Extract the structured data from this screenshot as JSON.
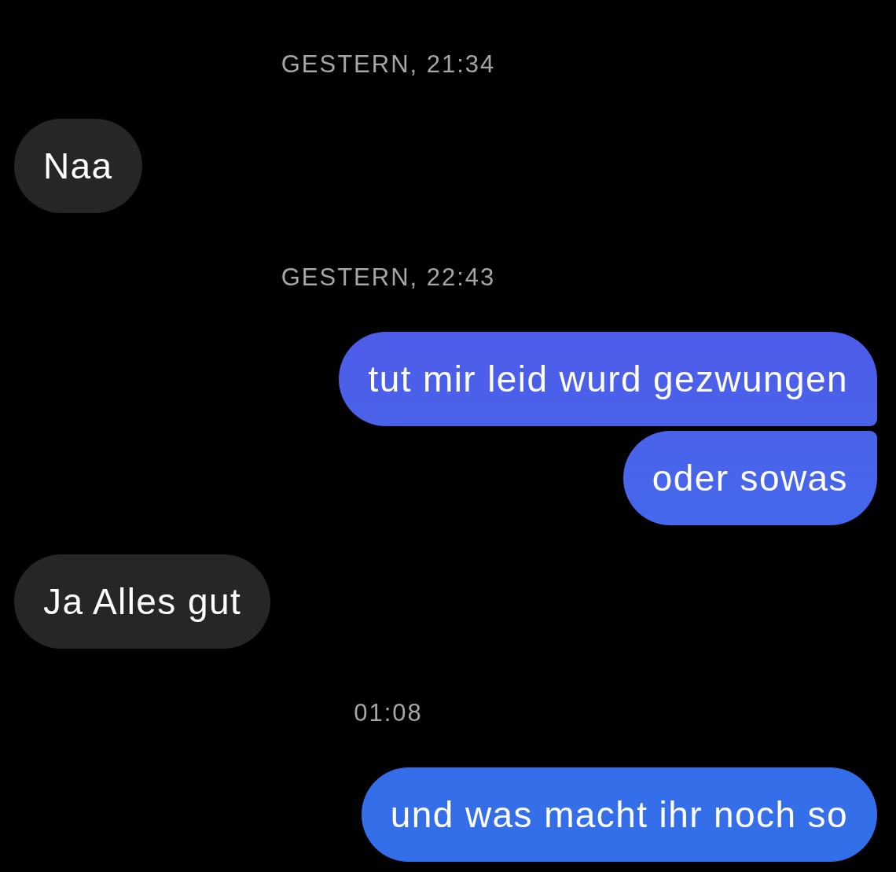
{
  "messages": [
    {
      "kind": "timestamp",
      "text": "GESTERN, 21:34"
    },
    {
      "kind": "received",
      "text": "Naa"
    },
    {
      "kind": "timestamp",
      "text": "GESTERN, 22:43"
    },
    {
      "kind": "sent",
      "text": "tut mir leid wurd gezwungen"
    },
    {
      "kind": "sent",
      "text": "oder sowas"
    },
    {
      "kind": "received",
      "text": "Ja Alles gut"
    },
    {
      "kind": "timestamp",
      "text": "01:08"
    },
    {
      "kind": "sent",
      "text": "und was macht ihr noch so"
    }
  ]
}
